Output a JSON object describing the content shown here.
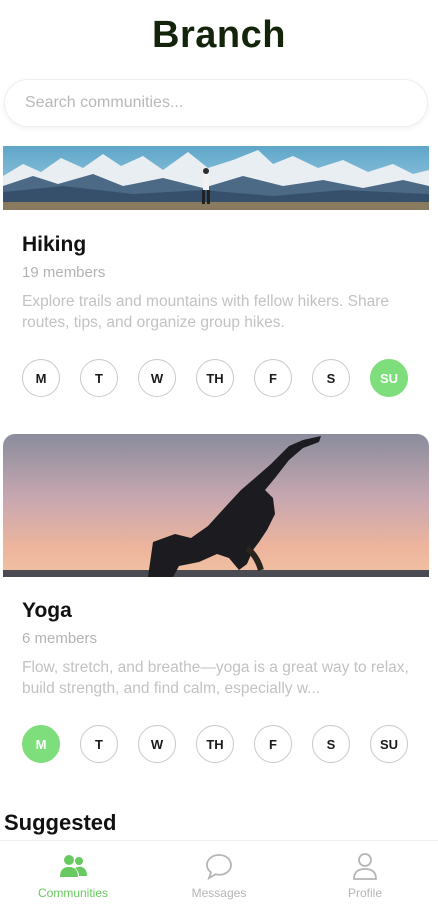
{
  "app": {
    "title": "Branch"
  },
  "search": {
    "placeholder": "Search communities..."
  },
  "communities": [
    {
      "name": "Hiking",
      "members": "19 members",
      "description": "Explore trails and mountains with fellow hikers. Share routes, tips, and organize group hikes.",
      "days": [
        "M",
        "T",
        "W",
        "TH",
        "F",
        "S",
        "SU"
      ],
      "active_day": "SU"
    },
    {
      "name": "Yoga",
      "members": "6 members",
      "description": "Flow, stretch, and breathe—yoga is a great way to relax, build strength, and find calm, especially w...",
      "days": [
        "M",
        "T",
        "W",
        "TH",
        "F",
        "S",
        "SU"
      ],
      "active_day": "M"
    }
  ],
  "section": {
    "suggested_label": "Suggested"
  },
  "tabs": [
    {
      "label": "Communities",
      "icon": "people-icon",
      "active": true
    },
    {
      "label": "Messages",
      "icon": "chat-bubble-icon",
      "active": false
    },
    {
      "label": "Profile",
      "icon": "person-icon",
      "active": false
    }
  ],
  "colors": {
    "accent": "#7ede7c",
    "title": "#14240a",
    "muted": "#b3b3b3"
  }
}
